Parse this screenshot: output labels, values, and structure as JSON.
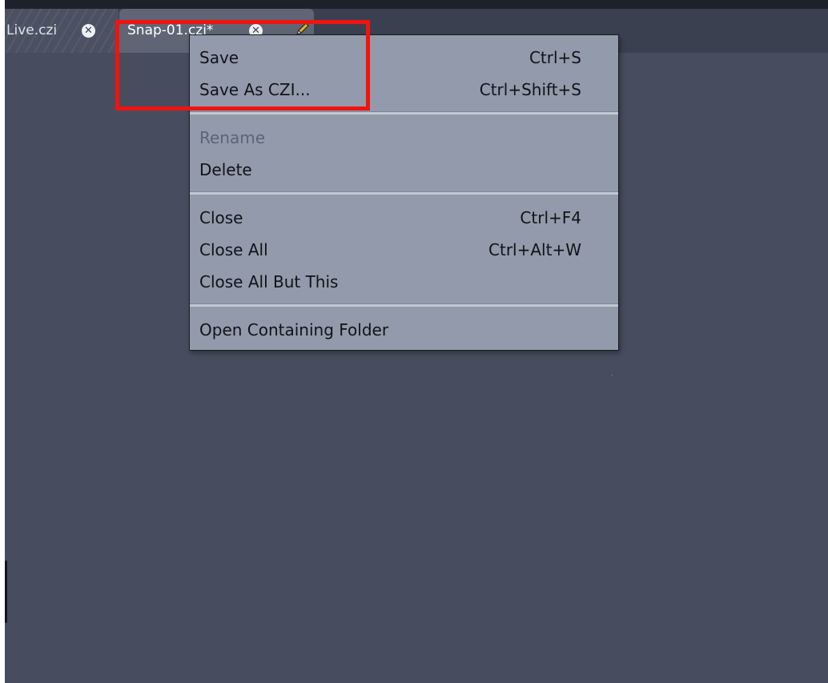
{
  "tabs": [
    {
      "label": "Live.czi",
      "close_icon": "close-circle-icon"
    },
    {
      "label": "Snap-01.czi*",
      "close_icon": "close-circle-icon",
      "edit_icon": "pencil-icon",
      "active": true
    }
  ],
  "context_menu": {
    "items": [
      {
        "label": "Save",
        "shortcut": "Ctrl+S",
        "enabled": true
      },
      {
        "label": "Save As CZI...",
        "shortcut": "Ctrl+Shift+S",
        "enabled": true
      },
      {
        "label": "Rename",
        "shortcut": "",
        "enabled": false
      },
      {
        "label": "Delete",
        "shortcut": "",
        "enabled": true
      },
      {
        "label": "Close",
        "shortcut": "Ctrl+F4",
        "enabled": true
      },
      {
        "label": "Close All",
        "shortcut": "Ctrl+Alt+W",
        "enabled": true
      },
      {
        "label": "Close All But This",
        "shortcut": "",
        "enabled": true
      },
      {
        "label": "Open Containing Folder",
        "shortcut": "",
        "enabled": true
      }
    ]
  },
  "colors": {
    "background": "#474d5f",
    "tab_bar": "#3b4050",
    "menu_background": "#929aab",
    "highlight": "#f0130f",
    "edit_icon": "#e8b21c"
  }
}
